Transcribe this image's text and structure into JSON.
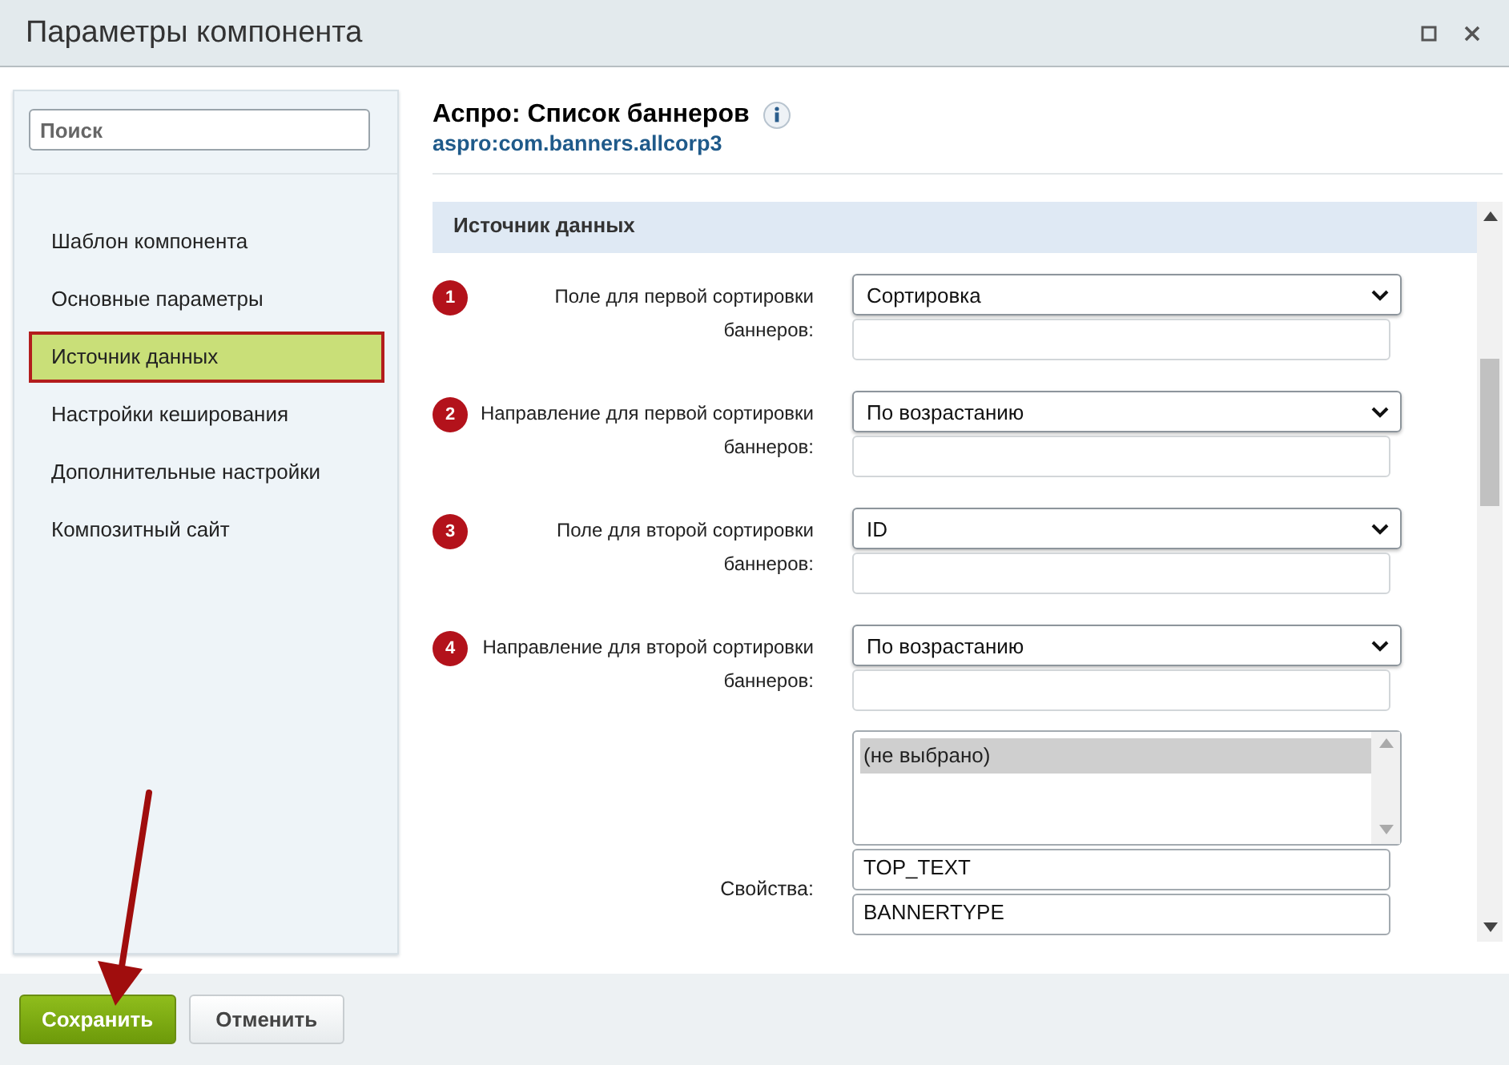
{
  "window": {
    "title": "Параметры компонента"
  },
  "sidebar": {
    "search": {
      "placeholder": "Поиск"
    },
    "items": [
      {
        "label": "Шаблон компонента",
        "selected": false
      },
      {
        "label": "Основные параметры",
        "selected": false
      },
      {
        "label": "Источник данных",
        "selected": true
      },
      {
        "label": "Настройки кеширования",
        "selected": false
      },
      {
        "label": "Дополнительные настройки",
        "selected": false
      },
      {
        "label": "Композитный сайт",
        "selected": false
      }
    ]
  },
  "component": {
    "title": "Аспро: Список баннеров",
    "code": "aspro:com.banners.allcorp3"
  },
  "section": {
    "title": "Источник данных"
  },
  "fields": [
    {
      "badge": "1",
      "label": "Поле для первой сортировки баннеров:",
      "value": "Сортировка"
    },
    {
      "badge": "2",
      "label": "Направление для первой сортировки баннеров:",
      "value": "По возрастанию"
    },
    {
      "badge": "3",
      "label": "Поле для второй сортировки баннеров:",
      "value": "ID"
    },
    {
      "badge": "4",
      "label": "Направление для второй сортировки баннеров:",
      "value": "По возрастанию"
    }
  ],
  "properties": {
    "label": "Свойства:",
    "options": [
      {
        "label": "(не выбрано)",
        "selected": true
      }
    ],
    "values": [
      "TOP_TEXT",
      "BANNERTYPE"
    ]
  },
  "buttons": [
    {
      "label": "Сохранить",
      "kind": "primary"
    },
    {
      "label": "Отменить",
      "kind": "secondary"
    }
  ]
}
